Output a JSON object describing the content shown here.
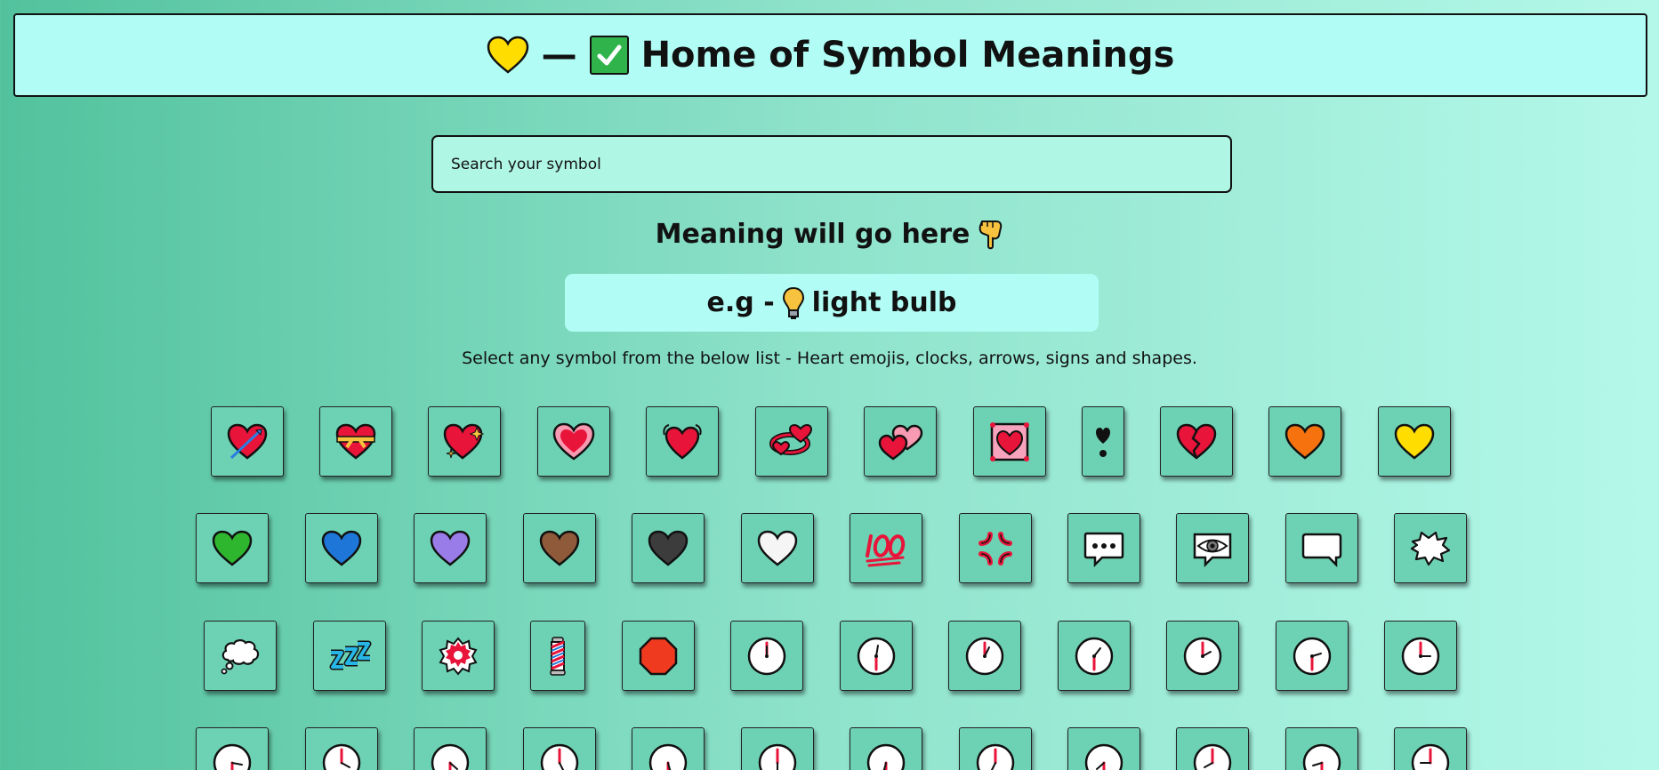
{
  "header": {
    "title": "Home of Symbol Meanings",
    "dash": "—",
    "heart_icon": "yellow-heart-icon",
    "check_icon": "check-mark-button-icon"
  },
  "search": {
    "placeholder": "Search your symbol"
  },
  "meaning": {
    "text": "Meaning will go here",
    "icon": "backhand-index-pointing-down-icon"
  },
  "example": {
    "prefix": "e.g -",
    "icon": "light-bulb-icon",
    "label": "light bulb"
  },
  "hint": "Select any symbol from the below list - Heart emojis, clocks, arrows, signs and shapes.",
  "colors": {
    "tile_bg": "#6dd2b3",
    "header_bg": "#b1fdf5",
    "search_bg": "#aff6e4",
    "gradient_left": "#52c29d",
    "gradient_right": "#b4f8e9"
  },
  "symbols": {
    "row1": [
      "heart-with-arrow-icon",
      "heart-with-ribbon-icon",
      "sparkling-heart-icon",
      "growing-heart-icon",
      "beating-heart-icon",
      "revolving-hearts-icon",
      "two-hearts-icon",
      "heart-decoration-icon",
      "heart-exclamation-icon",
      "broken-heart-icon",
      "orange-heart-icon",
      "yellow-heart-icon"
    ],
    "row2": [
      "green-heart-icon",
      "blue-heart-icon",
      "purple-heart-icon",
      "brown-heart-icon",
      "black-heart-icon",
      "white-heart-icon",
      "hundred-points-icon",
      "anger-symbol-icon",
      "speech-balloon-icon",
      "eye-in-speech-bubble-icon",
      "left-speech-bubble-icon",
      "right-anger-bubble-icon"
    ],
    "row3": [
      "thought-balloon-icon",
      "zzz-icon",
      "white-flower-icon",
      "barber-pole-icon",
      "stop-sign-icon",
      "twelve-oclock-icon",
      "twelve-thirty-icon",
      "one-oclock-icon",
      "one-thirty-icon",
      "two-oclock-icon",
      "two-thirty-icon",
      "three-oclock-icon"
    ],
    "row4": [
      "three-thirty-icon",
      "four-oclock-icon",
      "four-thirty-icon",
      "five-oclock-icon",
      "five-thirty-icon",
      "six-oclock-icon",
      "six-thirty-icon",
      "seven-oclock-icon",
      "seven-thirty-icon",
      "eight-oclock-icon",
      "eight-thirty-icon",
      "nine-oclock-icon"
    ]
  }
}
